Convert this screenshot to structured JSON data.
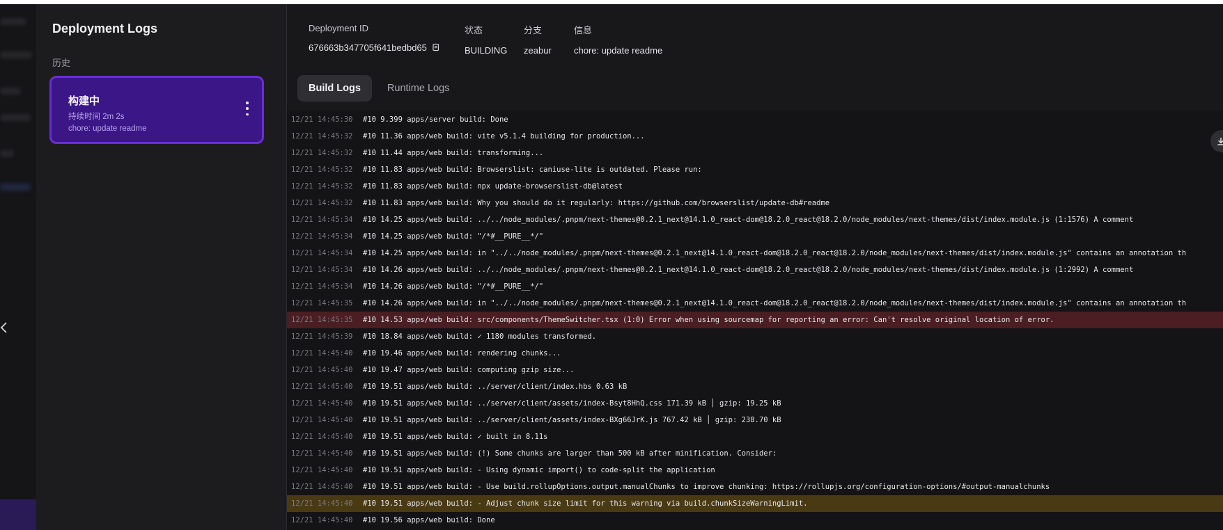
{
  "sidebar": {
    "title": "Deployment Logs",
    "history_label": "历史",
    "card": {
      "status": "构建中",
      "duration": "持续时间 2m 2s",
      "message": "chore: update readme"
    }
  },
  "info": {
    "deployment_id_label": "Deployment ID",
    "deployment_id": "676663b347705f641bedbd65",
    "status_label": "状态",
    "status": "BUILDING",
    "branch_label": "分支",
    "branch": "zeabur",
    "message_label": "信息",
    "message": "chore: update readme"
  },
  "tabs": [
    {
      "label": "Build Logs",
      "active": true
    },
    {
      "label": "Runtime Logs",
      "active": false
    }
  ],
  "logs": [
    {
      "time": "12/21 14:45:30",
      "msg": "#10 9.399 apps/server build: Done",
      "level": "info"
    },
    {
      "time": "12/21 14:45:32",
      "msg": "#10 11.36 apps/web build: vite v5.1.4 building for production...",
      "level": "info"
    },
    {
      "time": "12/21 14:45:32",
      "msg": "#10 11.44 apps/web build: transforming...",
      "level": "info"
    },
    {
      "time": "12/21 14:45:32",
      "msg": "#10 11.83 apps/web build: Browserslist: caniuse-lite is outdated. Please run:",
      "level": "info"
    },
    {
      "time": "12/21 14:45:32",
      "msg": "#10 11.83 apps/web build:   npx update-browserslist-db@latest",
      "level": "info"
    },
    {
      "time": "12/21 14:45:32",
      "msg": "#10 11.83 apps/web build:   Why you should do it regularly: https://github.com/browserslist/update-db#readme",
      "level": "info"
    },
    {
      "time": "12/21 14:45:34",
      "msg": "#10 14.25 apps/web build: ../../node_modules/.pnpm/next-themes@0.2.1_next@14.1.0_react-dom@18.2.0_react@18.2.0/node_modules/next-themes/dist/index.module.js (1:1576) A comment",
      "level": "info"
    },
    {
      "time": "12/21 14:45:34",
      "msg": "#10 14.25 apps/web build: \"/*#__PURE__*/\"",
      "level": "info"
    },
    {
      "time": "12/21 14:45:34",
      "msg": "#10 14.25 apps/web build: in \"../../node_modules/.pnpm/next-themes@0.2.1_next@14.1.0_react-dom@18.2.0_react@18.2.0/node_modules/next-themes/dist/index.module.js\" contains an annotation th",
      "level": "info"
    },
    {
      "time": "12/21 14:45:34",
      "msg": "#10 14.26 apps/web build: ../../node_modules/.pnpm/next-themes@0.2.1_next@14.1.0_react-dom@18.2.0_react@18.2.0/node_modules/next-themes/dist/index.module.js (1:2992) A comment",
      "level": "info"
    },
    {
      "time": "12/21 14:45:34",
      "msg": "#10 14.26 apps/web build: \"/*#__PURE__*/\"",
      "level": "info"
    },
    {
      "time": "12/21 14:45:35",
      "msg": "#10 14.26 apps/web build: in \"../../node_modules/.pnpm/next-themes@0.2.1_next@14.1.0_react-dom@18.2.0_react@18.2.0/node_modules/next-themes/dist/index.module.js\" contains an annotation th",
      "level": "info"
    },
    {
      "time": "12/21 14:45:35",
      "msg": "#10 14.53 apps/web build: src/components/ThemeSwitcher.tsx (1:0) Error when using sourcemap for reporting an error: Can't resolve original location of error.",
      "level": "error"
    },
    {
      "time": "12/21 14:45:39",
      "msg": "#10 18.84 apps/web build: ✓ 1180 modules transformed.",
      "level": "info"
    },
    {
      "time": "12/21 14:45:40",
      "msg": "#10 19.46 apps/web build: rendering chunks...",
      "level": "info"
    },
    {
      "time": "12/21 14:45:40",
      "msg": "#10 19.47 apps/web build: computing gzip size...",
      "level": "info"
    },
    {
      "time": "12/21 14:45:40",
      "msg": "#10 19.51 apps/web build: ../server/client/index.hbs                  0.63 kB",
      "level": "info"
    },
    {
      "time": "12/21 14:45:40",
      "msg": "#10 19.51 apps/web build: ../server/client/assets/index-Bsyt8HhQ.css  171.39 kB │ gzip:  19.25 kB",
      "level": "info"
    },
    {
      "time": "12/21 14:45:40",
      "msg": "#10 19.51 apps/web build: ../server/client/assets/index-BXg66JrK.js   767.42 kB │ gzip: 238.70 kB",
      "level": "info"
    },
    {
      "time": "12/21 14:45:40",
      "msg": "#10 19.51 apps/web build: ✓ built in 8.11s",
      "level": "info"
    },
    {
      "time": "12/21 14:45:40",
      "msg": "#10 19.51 apps/web build: (!) Some chunks are larger than 500 kB after minification. Consider:",
      "level": "info"
    },
    {
      "time": "12/21 14:45:40",
      "msg": "#10 19.51 apps/web build: - Using dynamic import() to code-split the application",
      "level": "info"
    },
    {
      "time": "12/21 14:45:40",
      "msg": "#10 19.51 apps/web build: - Use build.rollupOptions.output.manualChunks to improve chunking: https://rollupjs.org/configuration-options/#output-manualchunks",
      "level": "info"
    },
    {
      "time": "12/21 14:45:40",
      "msg": "#10 19.51 apps/web build: - Adjust chunk size limit for this warning via build.chunkSizeWarningLimit.",
      "level": "warn"
    },
    {
      "time": "12/21 14:45:40",
      "msg": "#10 19.56 apps/web build: Done",
      "level": "info"
    }
  ],
  "icons": {
    "copy": "copy-icon",
    "menu": "more-vertical-icon",
    "download": "download-icon",
    "collapse": "chevron-left-icon"
  },
  "colors": {
    "accent": "#6a2cd8",
    "card_bg": "#3b1687",
    "error_row": "#4a1e22",
    "warn_row": "#4a3a14"
  }
}
